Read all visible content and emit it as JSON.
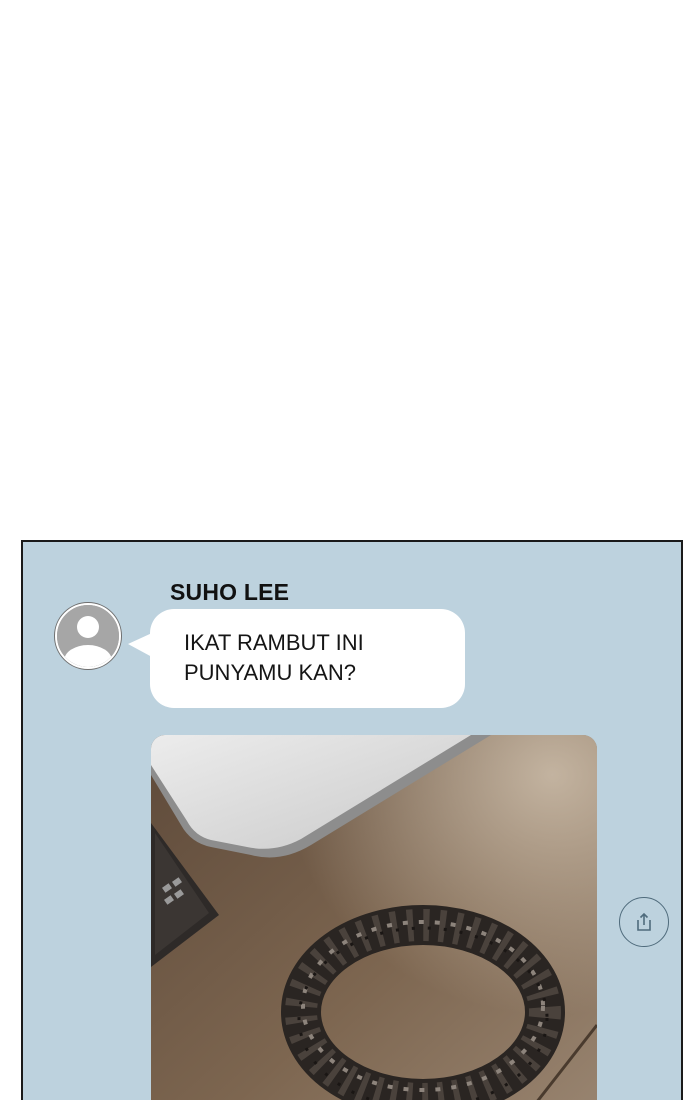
{
  "message": {
    "sender": "SUHO LEE",
    "lines": [
      "IKAT RAMBUT INI",
      "PUNYAMU KAN?"
    ]
  },
  "icons": {
    "avatar": "default-user-icon",
    "share": "share-icon"
  },
  "colors": {
    "chat_background": "#bdd2de",
    "bubble": "#ffffff",
    "avatar": "#a6a6a6",
    "share_icon": "#4f6b7c"
  }
}
